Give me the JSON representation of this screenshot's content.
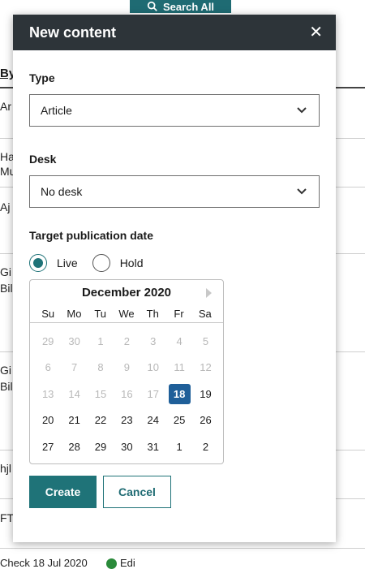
{
  "background": {
    "search_button": "Search All",
    "header_by": "By",
    "rows": [
      "Ar",
      "Ha",
      "Mu",
      "Aj",
      "Gi",
      "Bil",
      "Gi",
      "Bil",
      "hjl",
      "FT"
    ],
    "bottom_text": "Check          18 Jul 2020",
    "bottom_status": "Edi"
  },
  "modal": {
    "title": "New content",
    "close_symbol": "✕",
    "type_label": "Type",
    "type_value": "Article",
    "desk_label": "Desk",
    "desk_value": "No desk",
    "date_label": "Target publication date",
    "radio_live": "Live",
    "radio_hold": "Hold",
    "selected_radio": "Live",
    "create_label": "Create",
    "cancel_label": "Cancel"
  },
  "calendar": {
    "month": "December 2020",
    "weekdays": [
      "Su",
      "Mo",
      "Tu",
      "We",
      "Th",
      "Fr",
      "Sa"
    ],
    "selected_day": "18",
    "days": [
      [
        "29",
        "30",
        "1",
        "2",
        "3",
        "4",
        "5"
      ],
      [
        "6",
        "7",
        "8",
        "9",
        "10",
        "11",
        "12"
      ],
      [
        "13",
        "14",
        "15",
        "16",
        "17",
        "18",
        "19"
      ],
      [
        "20",
        "21",
        "22",
        "23",
        "24",
        "25",
        "26"
      ],
      [
        "27",
        "28",
        "29",
        "30",
        "31",
        "1",
        "2"
      ]
    ],
    "muted_count": 19
  },
  "colors": {
    "header_bg": "#2d3439",
    "primary": "#1f7378",
    "selected_day": "#1f5f99"
  }
}
